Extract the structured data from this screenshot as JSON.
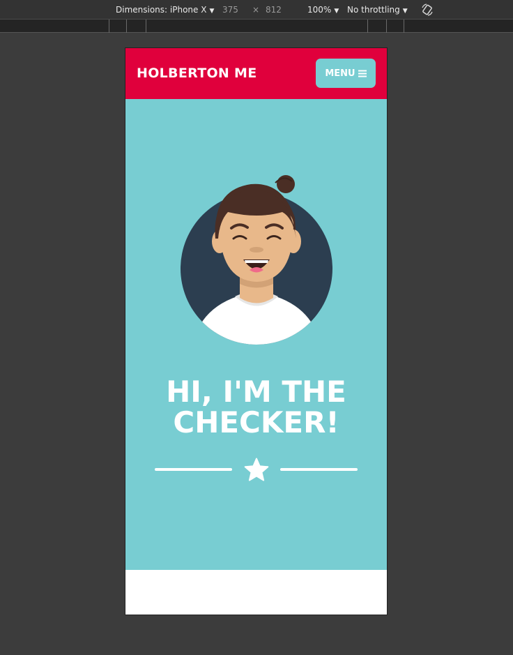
{
  "devtools": {
    "dimensions_label": "Dimensions: iPhone X",
    "width": "375",
    "times": "×",
    "height": "812",
    "zoom": "100%",
    "throttling": "No throttling",
    "rotate_icon": "rotate-icon"
  },
  "header": {
    "logo": "HOLBERTON ME",
    "menu_label": "MENU",
    "menu_icon": "hamburger-icon",
    "color": "#e0003c"
  },
  "hero": {
    "title_line1": "HI, I'M THE",
    "title_line2": "CHECKER!",
    "background": "#78cdd2",
    "avatar_icon": "avatar-icon",
    "divider_icon": "star-icon"
  }
}
